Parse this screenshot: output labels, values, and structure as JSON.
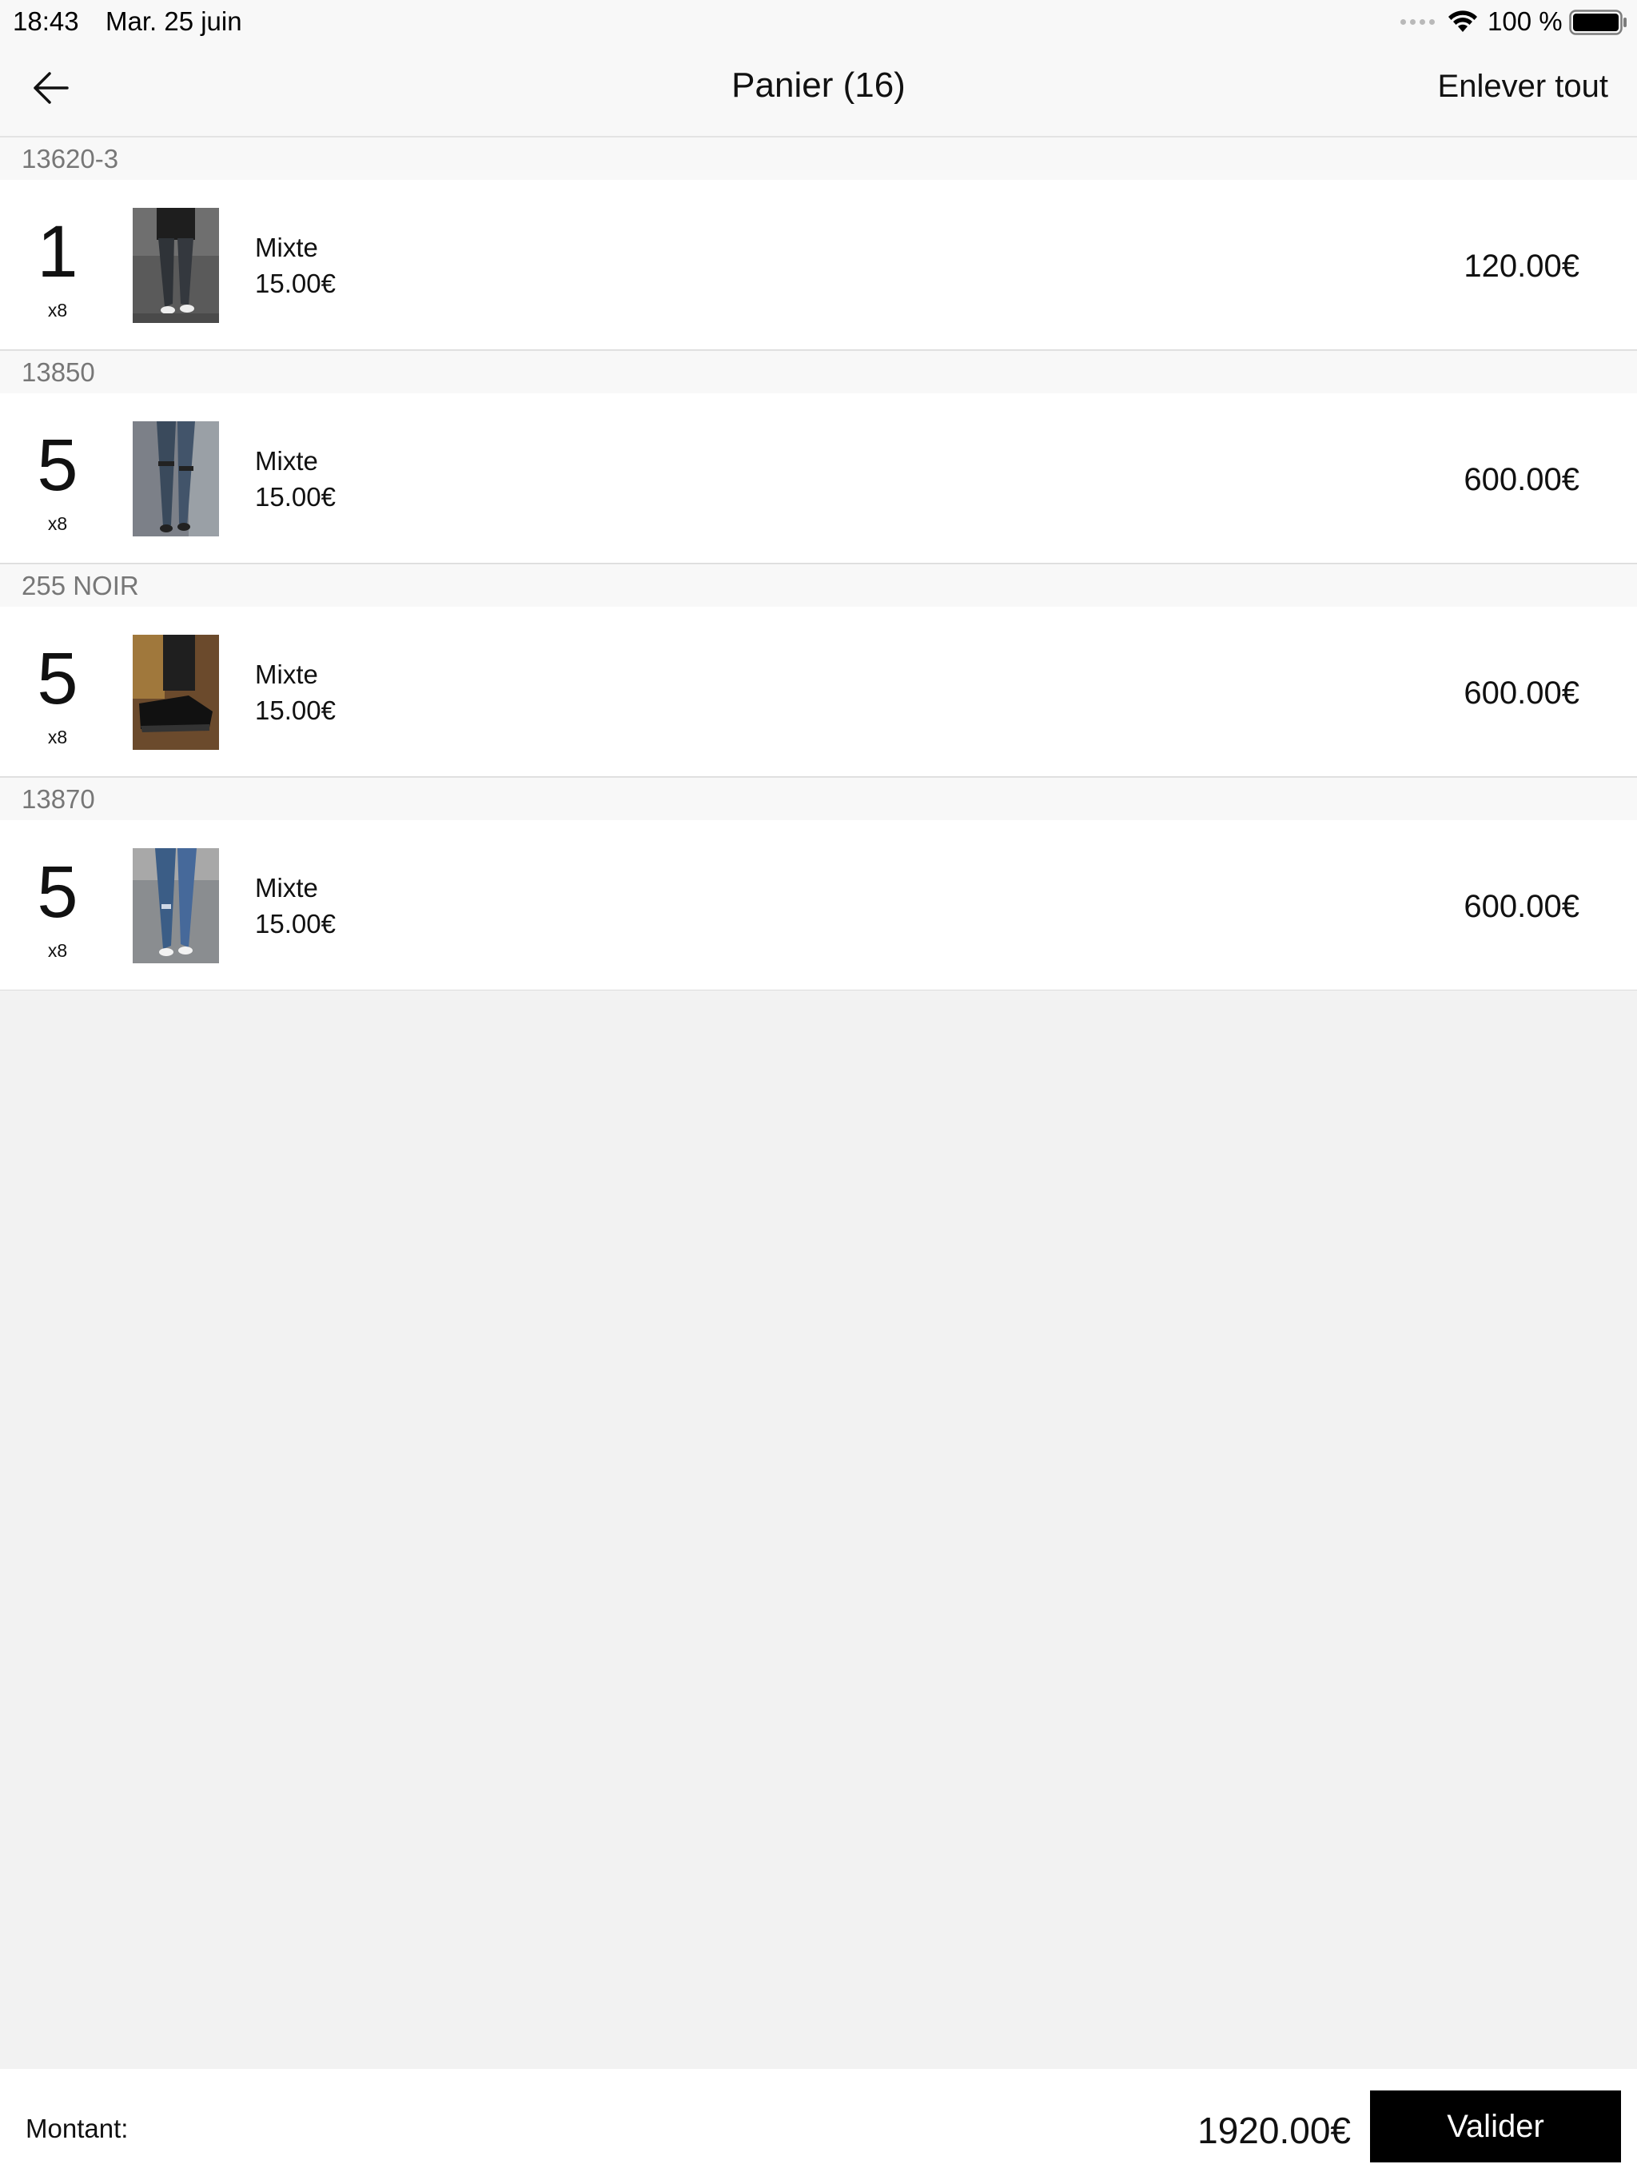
{
  "status_bar": {
    "time": "18:43",
    "date": "Mar. 25 juin",
    "battery_percent": "100 %"
  },
  "nav": {
    "back_icon": "arrow-left-icon",
    "title": "Panier (16)",
    "clear_all_label": "Enlever tout"
  },
  "cart": {
    "groups": [
      {
        "ref": "13620-3",
        "quantity": "1",
        "multiplier": "x8",
        "label": "Mixte",
        "unit_price": "15.00€",
        "line_total": "120.00€"
      },
      {
        "ref": "13850",
        "quantity": "5",
        "multiplier": "x8",
        "label": "Mixte",
        "unit_price": "15.00€",
        "line_total": "600.00€"
      },
      {
        "ref": "255 NOIR",
        "quantity": "5",
        "multiplier": "x8",
        "label": "Mixte",
        "unit_price": "15.00€",
        "line_total": "600.00€"
      },
      {
        "ref": "13870",
        "quantity": "5",
        "multiplier": "x8",
        "label": "Mixte",
        "unit_price": "15.00€",
        "line_total": "600.00€"
      }
    ]
  },
  "footer": {
    "amount_label": "Montant:",
    "amount_value": "1920.00€",
    "validate_label": "Valider"
  },
  "colors": {
    "background": "#f2f2f2",
    "bar": "#f8f8f8",
    "primary_button": "#000000",
    "group_header_text": "#777777"
  }
}
